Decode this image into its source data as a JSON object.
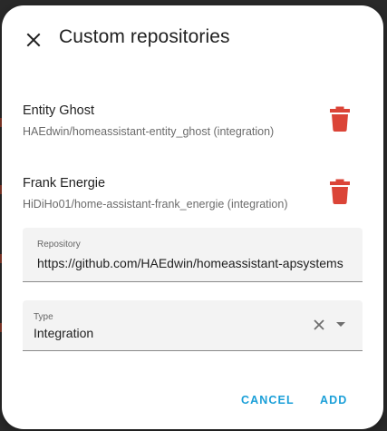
{
  "dialog": {
    "title": "Custom repositories",
    "repositories": [
      {
        "name": "Entity Ghost",
        "detail": "HAEdwin/homeassistant-entity_ghost (integration)"
      },
      {
        "name": "Frank Energie",
        "detail": "HiDiHo01/home-assistant-frank_energie (integration)"
      }
    ],
    "repository_field": {
      "label": "Repository",
      "value": "https://github.com/HAEdwin/homeassistant-apsystems"
    },
    "type_field": {
      "label": "Type",
      "value": "Integration"
    },
    "actions": {
      "cancel": "CANCEL",
      "add": "ADD"
    }
  },
  "colors": {
    "accent": "#1a9fd8",
    "delete": "#db4437",
    "backdrop_accent": "#8b3a2a"
  },
  "icons": {
    "close": "close-icon",
    "delete": "trash-icon",
    "clear": "clear-icon",
    "dropdown": "chevron-down-icon"
  }
}
